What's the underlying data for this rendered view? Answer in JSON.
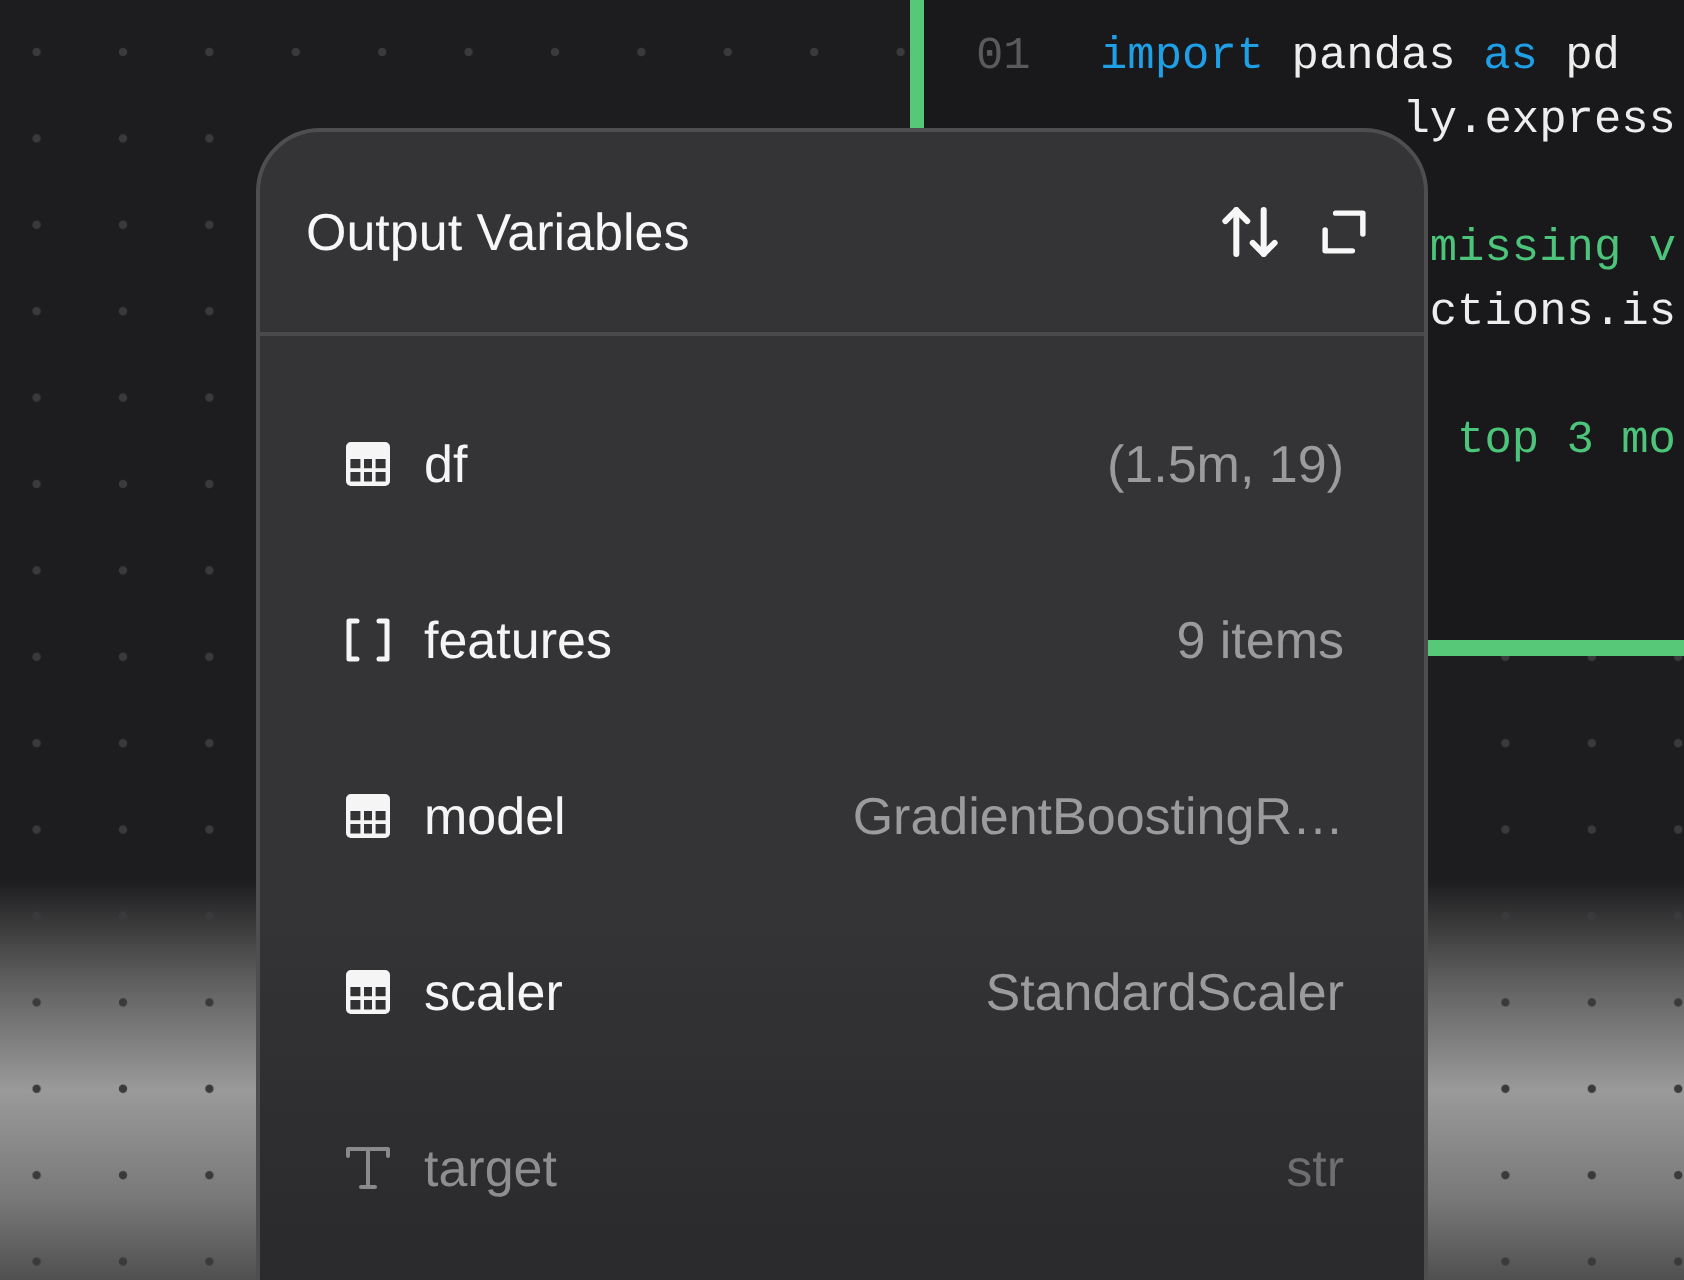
{
  "editor": {
    "lines": [
      {
        "kind": "code",
        "number": "01",
        "tokens": [
          {
            "text": "import",
            "kind": "keyword"
          },
          {
            "text": "pandas",
            "kind": "plain"
          },
          {
            "text": "as",
            "kind": "keyword"
          },
          {
            "text": "pd",
            "kind": "plain"
          }
        ]
      },
      {
        "kind": "covered",
        "tokens": [
          {
            "text": "ly.express",
            "kind": "plain"
          }
        ]
      },
      {
        "kind": "blank"
      },
      {
        "kind": "covered",
        "tokens": [
          {
            "text": "missing v",
            "kind": "comment"
          }
        ]
      },
      {
        "kind": "covered",
        "tokens": [
          {
            "text": "ctions.is",
            "kind": "plain"
          }
        ]
      },
      {
        "kind": "blank"
      },
      {
        "kind": "covered",
        "tokens": [
          {
            "text": "top 3 mo",
            "kind": "comment"
          }
        ]
      }
    ]
  },
  "panel": {
    "title": "Output Variables",
    "variables": [
      {
        "kind": "table",
        "name": "df",
        "value": "(1.5m, 19)",
        "dimmed": false
      },
      {
        "kind": "array",
        "name": "features",
        "value": "9 items",
        "dimmed": false
      },
      {
        "kind": "table",
        "name": "model",
        "value": "GradientBoostingR…",
        "dimmed": false
      },
      {
        "kind": "table",
        "name": "scaler",
        "value": "StandardScaler",
        "dimmed": false
      },
      {
        "kind": "string",
        "name": "target",
        "value": "str",
        "dimmed": true
      }
    ]
  }
}
